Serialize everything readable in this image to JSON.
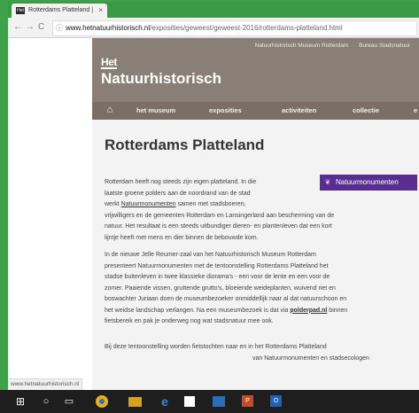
{
  "browser": {
    "tab_title": "Rotterdams Platteland | ",
    "tab_close": "×",
    "nav_back": "←",
    "nav_forward": "→",
    "nav_reload": "C",
    "url_host": "www.hetnatuurhistorisch.nl",
    "url_path": "/exposities/geweest/geweest-2016/rotterdams-platteland.html"
  },
  "header": {
    "top_links": [
      "Natuurhistorisch Museum Rotterdam",
      "Bureau Stadsnatuur"
    ],
    "logo_het": "Het",
    "logo_name": "Natuurhistorisch"
  },
  "menu": {
    "items": [
      "het museum",
      "exposities",
      "activiteiten",
      "collectie",
      "e"
    ]
  },
  "content": {
    "title": "Rotterdams Platteland",
    "badge": "Natuurmonumenten",
    "p1_l1": "Rotterdam heeft nog steeds zijn eigen platteland. In die",
    "p1_l2": "laatste groene polders aan de noordrand van de stad",
    "p1_l3_pre": "werkt ",
    "p1_l3_link": "Natuurmonumenten",
    "p1_l3_post": " samen met stadsboeren,",
    "p1_l4": "vrijwilligers en de gemeenten Rotterdam en Lansingerland aan bescherming van de",
    "p1_l5": "natuur. Het resultaat is een steeds uitbundiger dieren- en plantenleven dat een kort",
    "p1_l6": "lijntje heeft met mens en dier binnen de bebouwde kom.",
    "p2_l1": "In de nieuwe Jelle Reumer-zaal van het Natuurhistorisch Museum Rotterdam",
    "p2_l2": "presenteert Natuurmonumenten met de tentoonstelling Rotterdams Platteland het",
    "p2_l3": "stadse buitenleven in twee klassieke diorama's - een voor de lente en een voor de",
    "p2_l4": "zomer. Paaiende vissen, gruttende grutto's, bloeiende weideplanten, wuivend riet en",
    "p2_l5": "boswachter Juriaan doen de museumbezoeker onmiddellijk naar al dat natuurschoon en",
    "p2_l6": "het weidse landschap verlangen. Na een museumbezoek is dat via ",
    "p2_l6_link": "polderpad.nl",
    "p2_l6_post": " binnen",
    "p2_l7": "fietsbereik en pak je onderweg nog wat stadsnatuur mee ook.",
    "p3_l1": "Bij deze tentoonstelling worden fietstochten naar en in het Rotterdams Platteland",
    "p3_l2": "van Natuurmonumenten en stadsecologen"
  },
  "status_url": "www.hetnatuurhistorisch.nl",
  "taskbar": {
    "ppt": "P",
    "outlook": "O"
  }
}
